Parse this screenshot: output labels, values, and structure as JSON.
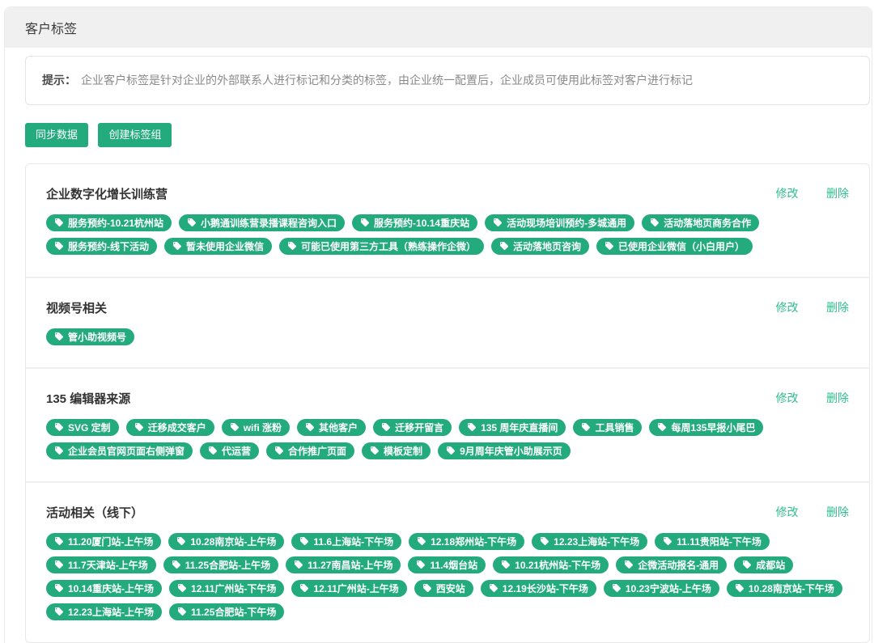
{
  "page": {
    "title": "客户标签"
  },
  "tip": {
    "label": "提示：",
    "text": "企业客户标签是针对企业的外部联系人进行标记和分类的标签，由企业统一配置后，企业成员可使用此标签对客户进行标记"
  },
  "toolbar": {
    "sync_button": "同步数据",
    "create_button": "创建标签组"
  },
  "group_actions": {
    "edit": "修改",
    "delete": "删除"
  },
  "colors": {
    "accent_green": "#23ab7d",
    "link_green": "#2fbd8d",
    "header_bg": "#f0f0f0"
  },
  "icons": {
    "tag_pill_icon": "tag-icon"
  },
  "groups": [
    {
      "name": "企业数字化增长训练营",
      "tags": [
        "服务预约-10.21杭州站",
        "小鹅通训练营录播课程咨询入口",
        "服务预约-10.14重庆站",
        "活动现场培训预约-多城通用",
        "活动落地页商务合作",
        "服务预约-线下活动",
        "暂未使用企业微信",
        "可能已使用第三方工具（熟练操作企微）",
        "活动落地页咨询",
        "已使用企业微信（小白用户）"
      ]
    },
    {
      "name": "视频号相关",
      "tags": [
        "管小助视频号"
      ]
    },
    {
      "name": "135 编辑器来源",
      "tags": [
        "SVG 定制",
        "迁移成交客户",
        "wifi 涨粉",
        "其他客户",
        "迁移开留言",
        "135 周年庆直播间",
        "工具销售",
        "每周135早报小尾巴",
        "企业会员官网页面右侧弹窗",
        "代运营",
        "合作推广页面",
        "模板定制",
        "9月周年庆管小助展示页"
      ]
    },
    {
      "name": "活动相关（线下）",
      "tags": [
        "11.20厦门站-上午场",
        "10.28南京站-上午场",
        "11.6上海站-下午场",
        "12.18郑州站-下午场",
        "12.23上海站-下午场",
        "11.11贵阳站-下午场",
        "11.7天津站-上午场",
        "11.25合肥站-上午场",
        "11.27南昌站-上午场",
        "11.4烟台站",
        "10.21杭州站-下午场",
        "企微活动报名-通用",
        "成都站",
        "10.14重庆站-上午场",
        "12.11广州站-下午场",
        "12.11广州站-上午场",
        "西安站",
        "12.19长沙站-下午场",
        "10.23宁波站-上午场",
        "10.28南京站-下午场",
        "12.23上海站-上午场",
        "11.25合肥站-下午场"
      ]
    }
  ]
}
